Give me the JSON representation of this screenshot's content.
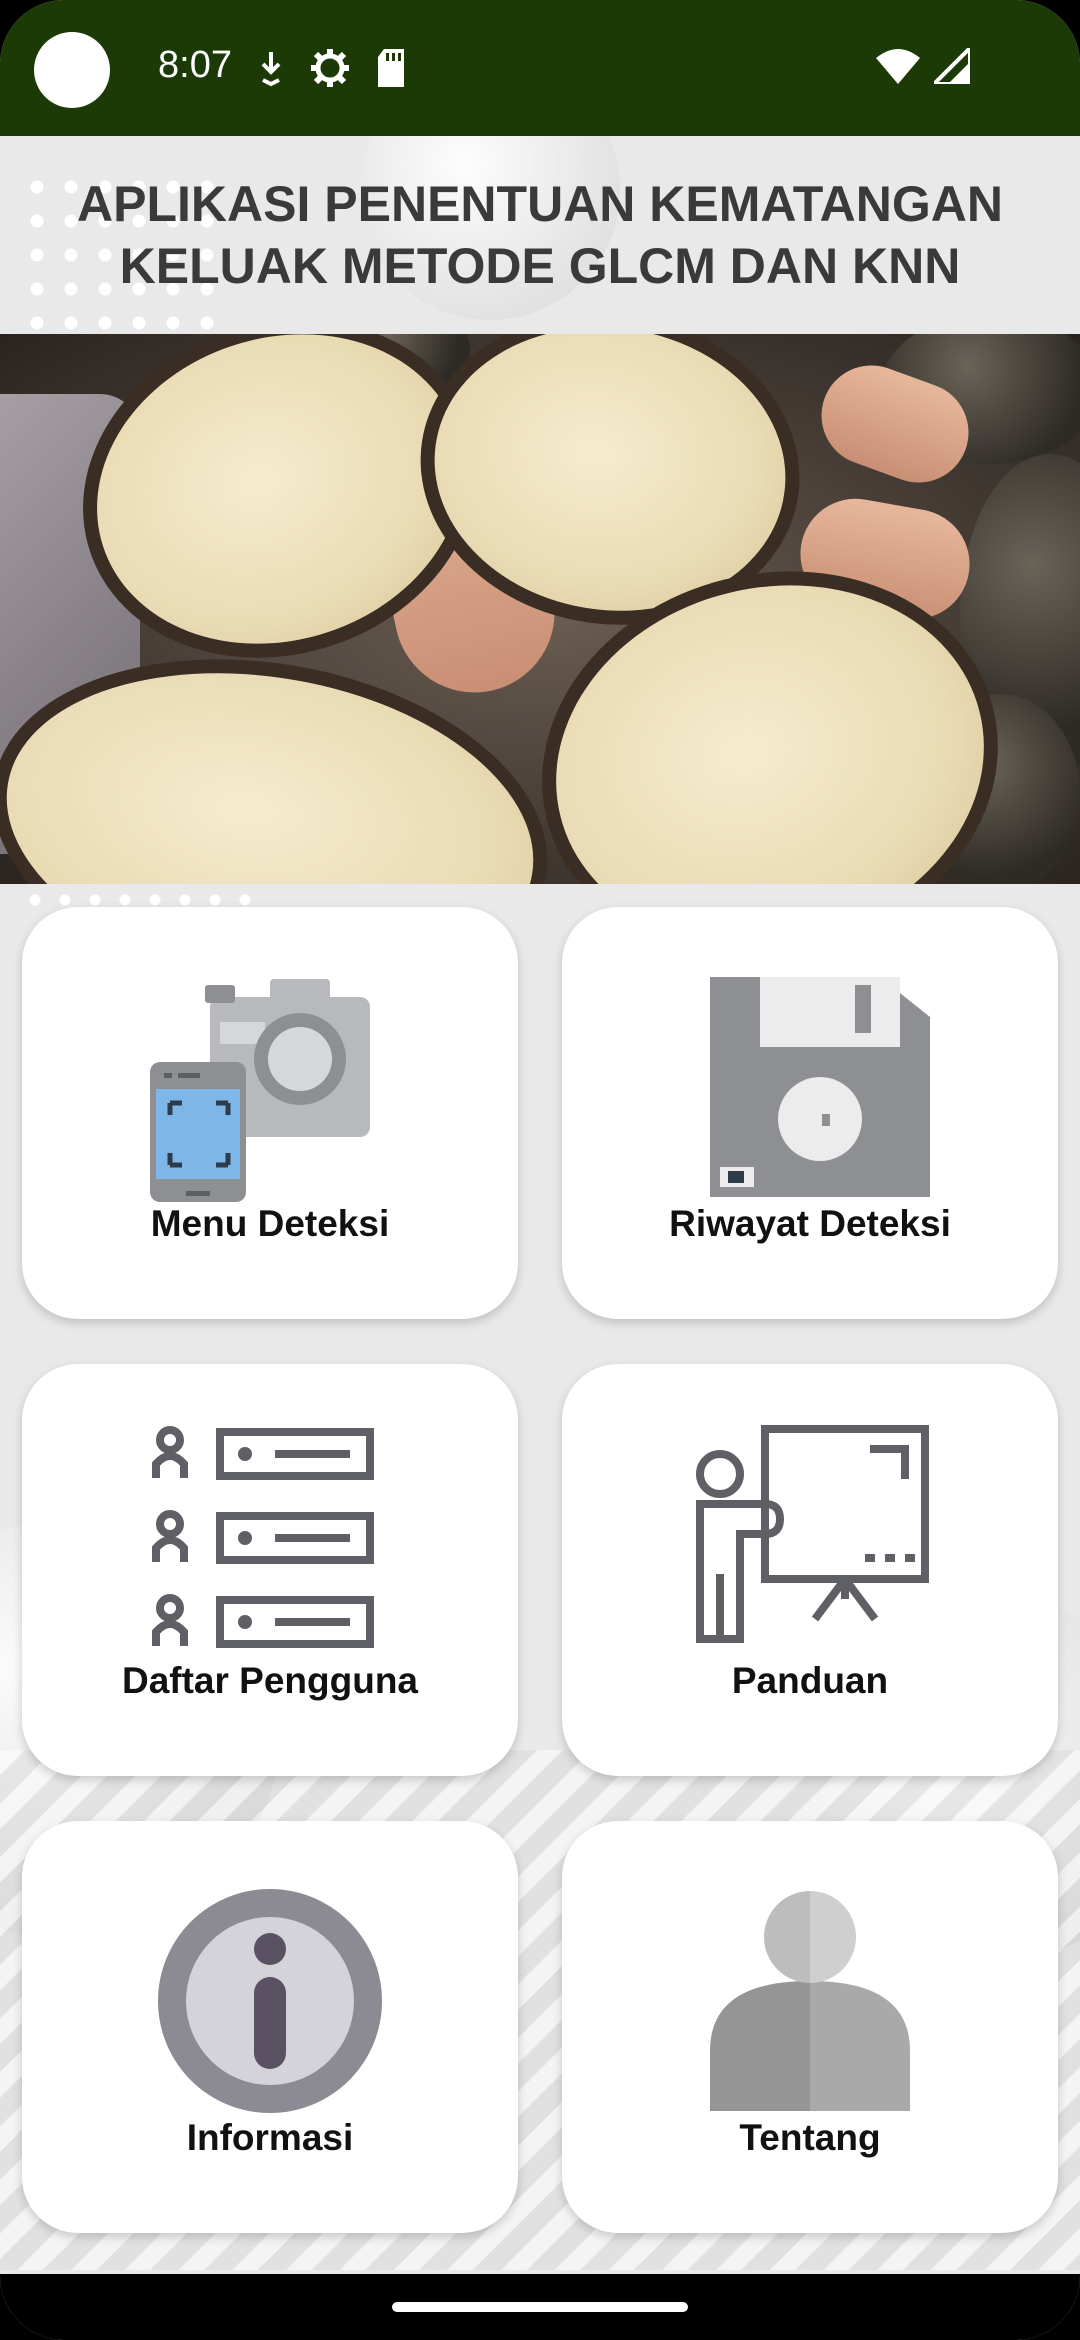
{
  "status_bar": {
    "time": "8:07",
    "background": "#1c3a05",
    "left_icons": [
      "download-icon",
      "settings-icon",
      "sd-card-icon"
    ],
    "right_icons": [
      "wifi-icon",
      "signal-icon"
    ]
  },
  "header": {
    "title_line1": "APLIKASI PENENTUAN KEMATANGAN",
    "title_line2": "KELUAK METODE GLCM DAN KNN"
  },
  "hero": {
    "icon": "keluak-photo"
  },
  "menu": {
    "deteksi": {
      "label": "Menu Deteksi",
      "icon": "camera-phone-icon"
    },
    "riwayat": {
      "label": "Riwayat Deteksi",
      "icon": "floppy-disk-icon"
    },
    "pengguna": {
      "label": "Daftar Pengguna",
      "icon": "user-list-icon"
    },
    "panduan": {
      "label": "Panduan",
      "icon": "presentation-icon"
    },
    "informasi": {
      "label": "Informasi",
      "icon": "info-icon"
    },
    "tentang": {
      "label": "Tentang",
      "icon": "person-icon"
    }
  }
}
